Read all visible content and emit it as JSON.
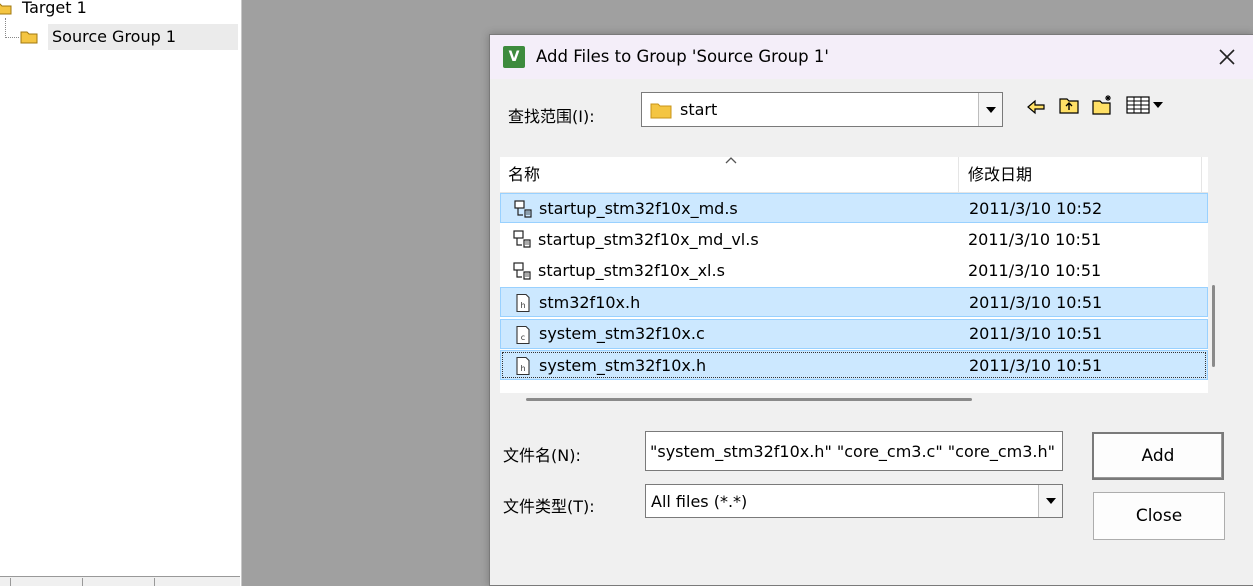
{
  "project_tree": {
    "target_label": "Target 1",
    "group_label": "Source Group 1"
  },
  "dialog": {
    "title": "Add Files to Group 'Source Group 1'",
    "app_icon_text": "V",
    "look_in_label": "查找范围(I):",
    "look_in_value": "start",
    "columns": {
      "name": "名称",
      "date": "修改日期"
    },
    "files": [
      {
        "name": "startup_stm32f10x_md.s",
        "date": "2011/3/10 10:52",
        "type": "asm",
        "selected": true,
        "focused": false
      },
      {
        "name": "startup_stm32f10x_md_vl.s",
        "date": "2011/3/10 10:51",
        "type": "asm",
        "selected": false,
        "focused": false
      },
      {
        "name": "startup_stm32f10x_xl.s",
        "date": "2011/3/10 10:51",
        "type": "asm",
        "selected": false,
        "focused": false
      },
      {
        "name": "stm32f10x.h",
        "date": "2011/3/10 10:51",
        "type": "h",
        "selected": true,
        "focused": false
      },
      {
        "name": "system_stm32f10x.c",
        "date": "2011/3/10 10:51",
        "type": "c",
        "selected": true,
        "focused": false
      },
      {
        "name": "system_stm32f10x.h",
        "date": "2011/3/10 10:51",
        "type": "h",
        "selected": true,
        "focused": true
      }
    ],
    "filename_label": "文件名(N):",
    "filename_value": "\"system_stm32f10x.h\" \"core_cm3.c\" \"core_cm3.h\"",
    "filetype_label": "文件类型(T):",
    "filetype_value": "All files (*.*)",
    "add_button": "Add",
    "close_button": "Close"
  },
  "colors": {
    "selection_bg": "#cce8ff",
    "selection_border": "#99d1ff",
    "title_bg": "#f4eef9",
    "workspace_bg": "#a0a0a0",
    "folder": "#f4c542"
  }
}
